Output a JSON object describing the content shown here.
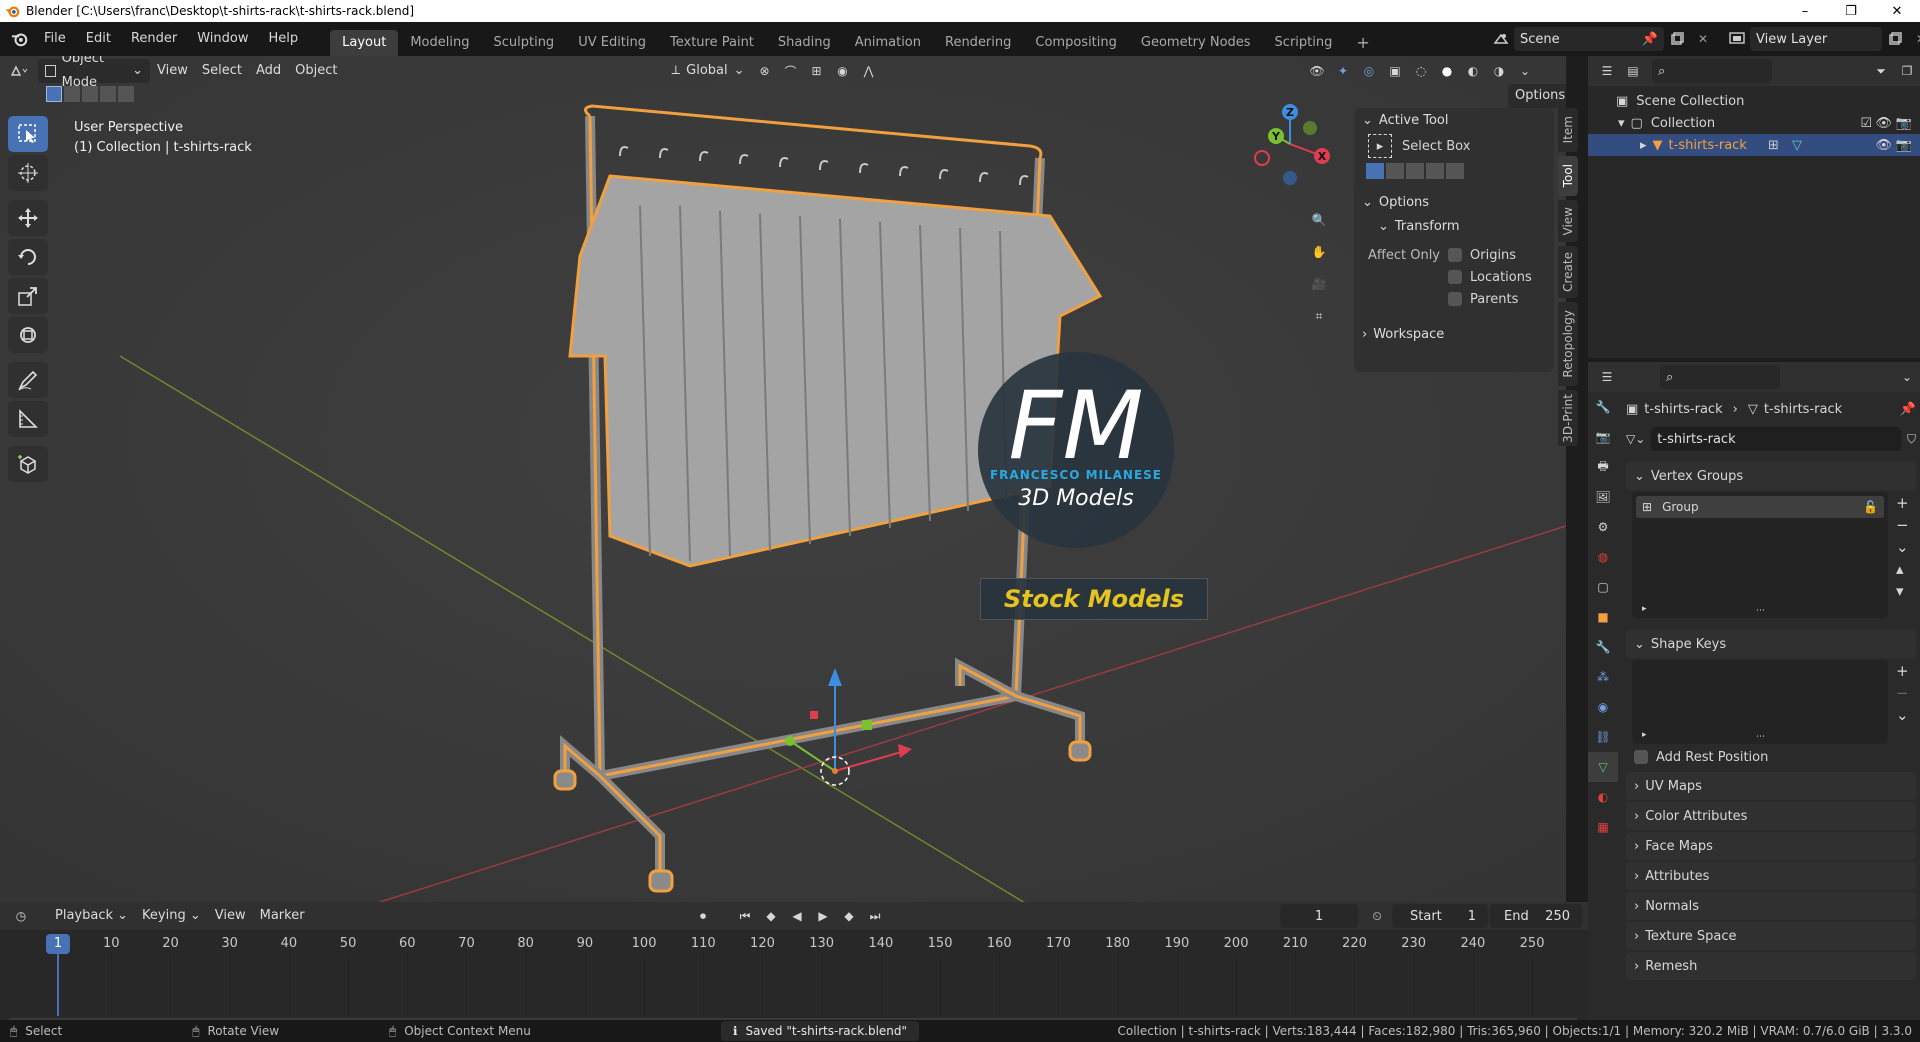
{
  "window": {
    "title": "Blender [C:\\Users\\franc\\Desktop\\t-shirts-rack\\t-shirts-rack.blend]",
    "controls": [
      "–",
      "❐",
      "✕"
    ]
  },
  "menu": [
    "File",
    "Edit",
    "Render",
    "Window",
    "Help"
  ],
  "workspaces": [
    "Layout",
    "Modeling",
    "Sculpting",
    "UV Editing",
    "Texture Paint",
    "Shading",
    "Animation",
    "Rendering",
    "Compositing",
    "Geometry Nodes",
    "Scripting"
  ],
  "active_workspace": "Layout",
  "scene": {
    "name": "Scene",
    "view_layer": "View Layer"
  },
  "viewport": {
    "mode": "Object Mode",
    "menus": [
      "View",
      "Select",
      "Add",
      "Object"
    ],
    "orientation": "Global",
    "options_label": "Options",
    "overlay_line1": "User Perspective",
    "overlay_line2": "(1) Collection | t-shirts-rack",
    "gizmo_axes": [
      "Z",
      "Y",
      "X"
    ]
  },
  "watermark": {
    "line1": "FM",
    "line2": "FRANCESCO MILANESE",
    "line3": "3D Models",
    "banner": "Stock Models"
  },
  "npanel": {
    "active_tool_header": "Active Tool",
    "tool_name": "Select Box",
    "options_header": "Options",
    "transform_header": "Transform",
    "affect_only": "Affect Only",
    "checkboxes": [
      "Origins",
      "Locations",
      "Parents"
    ],
    "workspace_header": "Workspace",
    "tabs": [
      "Item",
      "Tool",
      "View",
      "Create",
      "Retopology",
      "3D-Print"
    ],
    "active_tab": "Tool"
  },
  "outliner": {
    "scene_collection": "Scene Collection",
    "collection": "Collection",
    "object": "t-shirts-rack"
  },
  "properties": {
    "breadcrumb_object": "t-shirts-rack",
    "breadcrumb_data": "t-shirts-rack",
    "data_name": "t-shirts-rack",
    "vertex_groups_header": "Vertex Groups",
    "vertex_group": "Group",
    "shape_keys_header": "Shape Keys",
    "add_rest_position": "Add Rest Position",
    "collapsed_panels": [
      "UV Maps",
      "Color Attributes",
      "Face Maps",
      "Attributes",
      "Normals",
      "Texture Space",
      "Remesh"
    ]
  },
  "timeline": {
    "menus": [
      "Playback",
      "Keying",
      "View",
      "Marker"
    ],
    "current_frame": "1",
    "start_label": "Start",
    "start": "1",
    "end_label": "End",
    "end": "250",
    "ruler_marks": [
      "10",
      "20",
      "30",
      "40",
      "50",
      "60",
      "70",
      "80",
      "90",
      "100",
      "110",
      "120",
      "130",
      "140",
      "150",
      "160",
      "170",
      "180",
      "190",
      "200",
      "210",
      "220",
      "230",
      "240",
      "250"
    ],
    "playhead": "1"
  },
  "status": {
    "select": "Select",
    "rotate": "Rotate View",
    "context": "Object Context Menu",
    "saved": "Saved \"t-shirts-rack.blend\"",
    "stats": "Collection | t-shirts-rack | Verts:183,444 | Faces:182,980 | Tris:365,960 | Objects:1/1 | Memory: 320.2 MiB | VRAM: 0.7/6.0 GiB | 3.3.0"
  },
  "colors": {
    "accent": "#4772b3",
    "selection_outline": "#f0a040",
    "watermark_blue": "#2aa9e0",
    "banner_text": "#e6c420"
  }
}
